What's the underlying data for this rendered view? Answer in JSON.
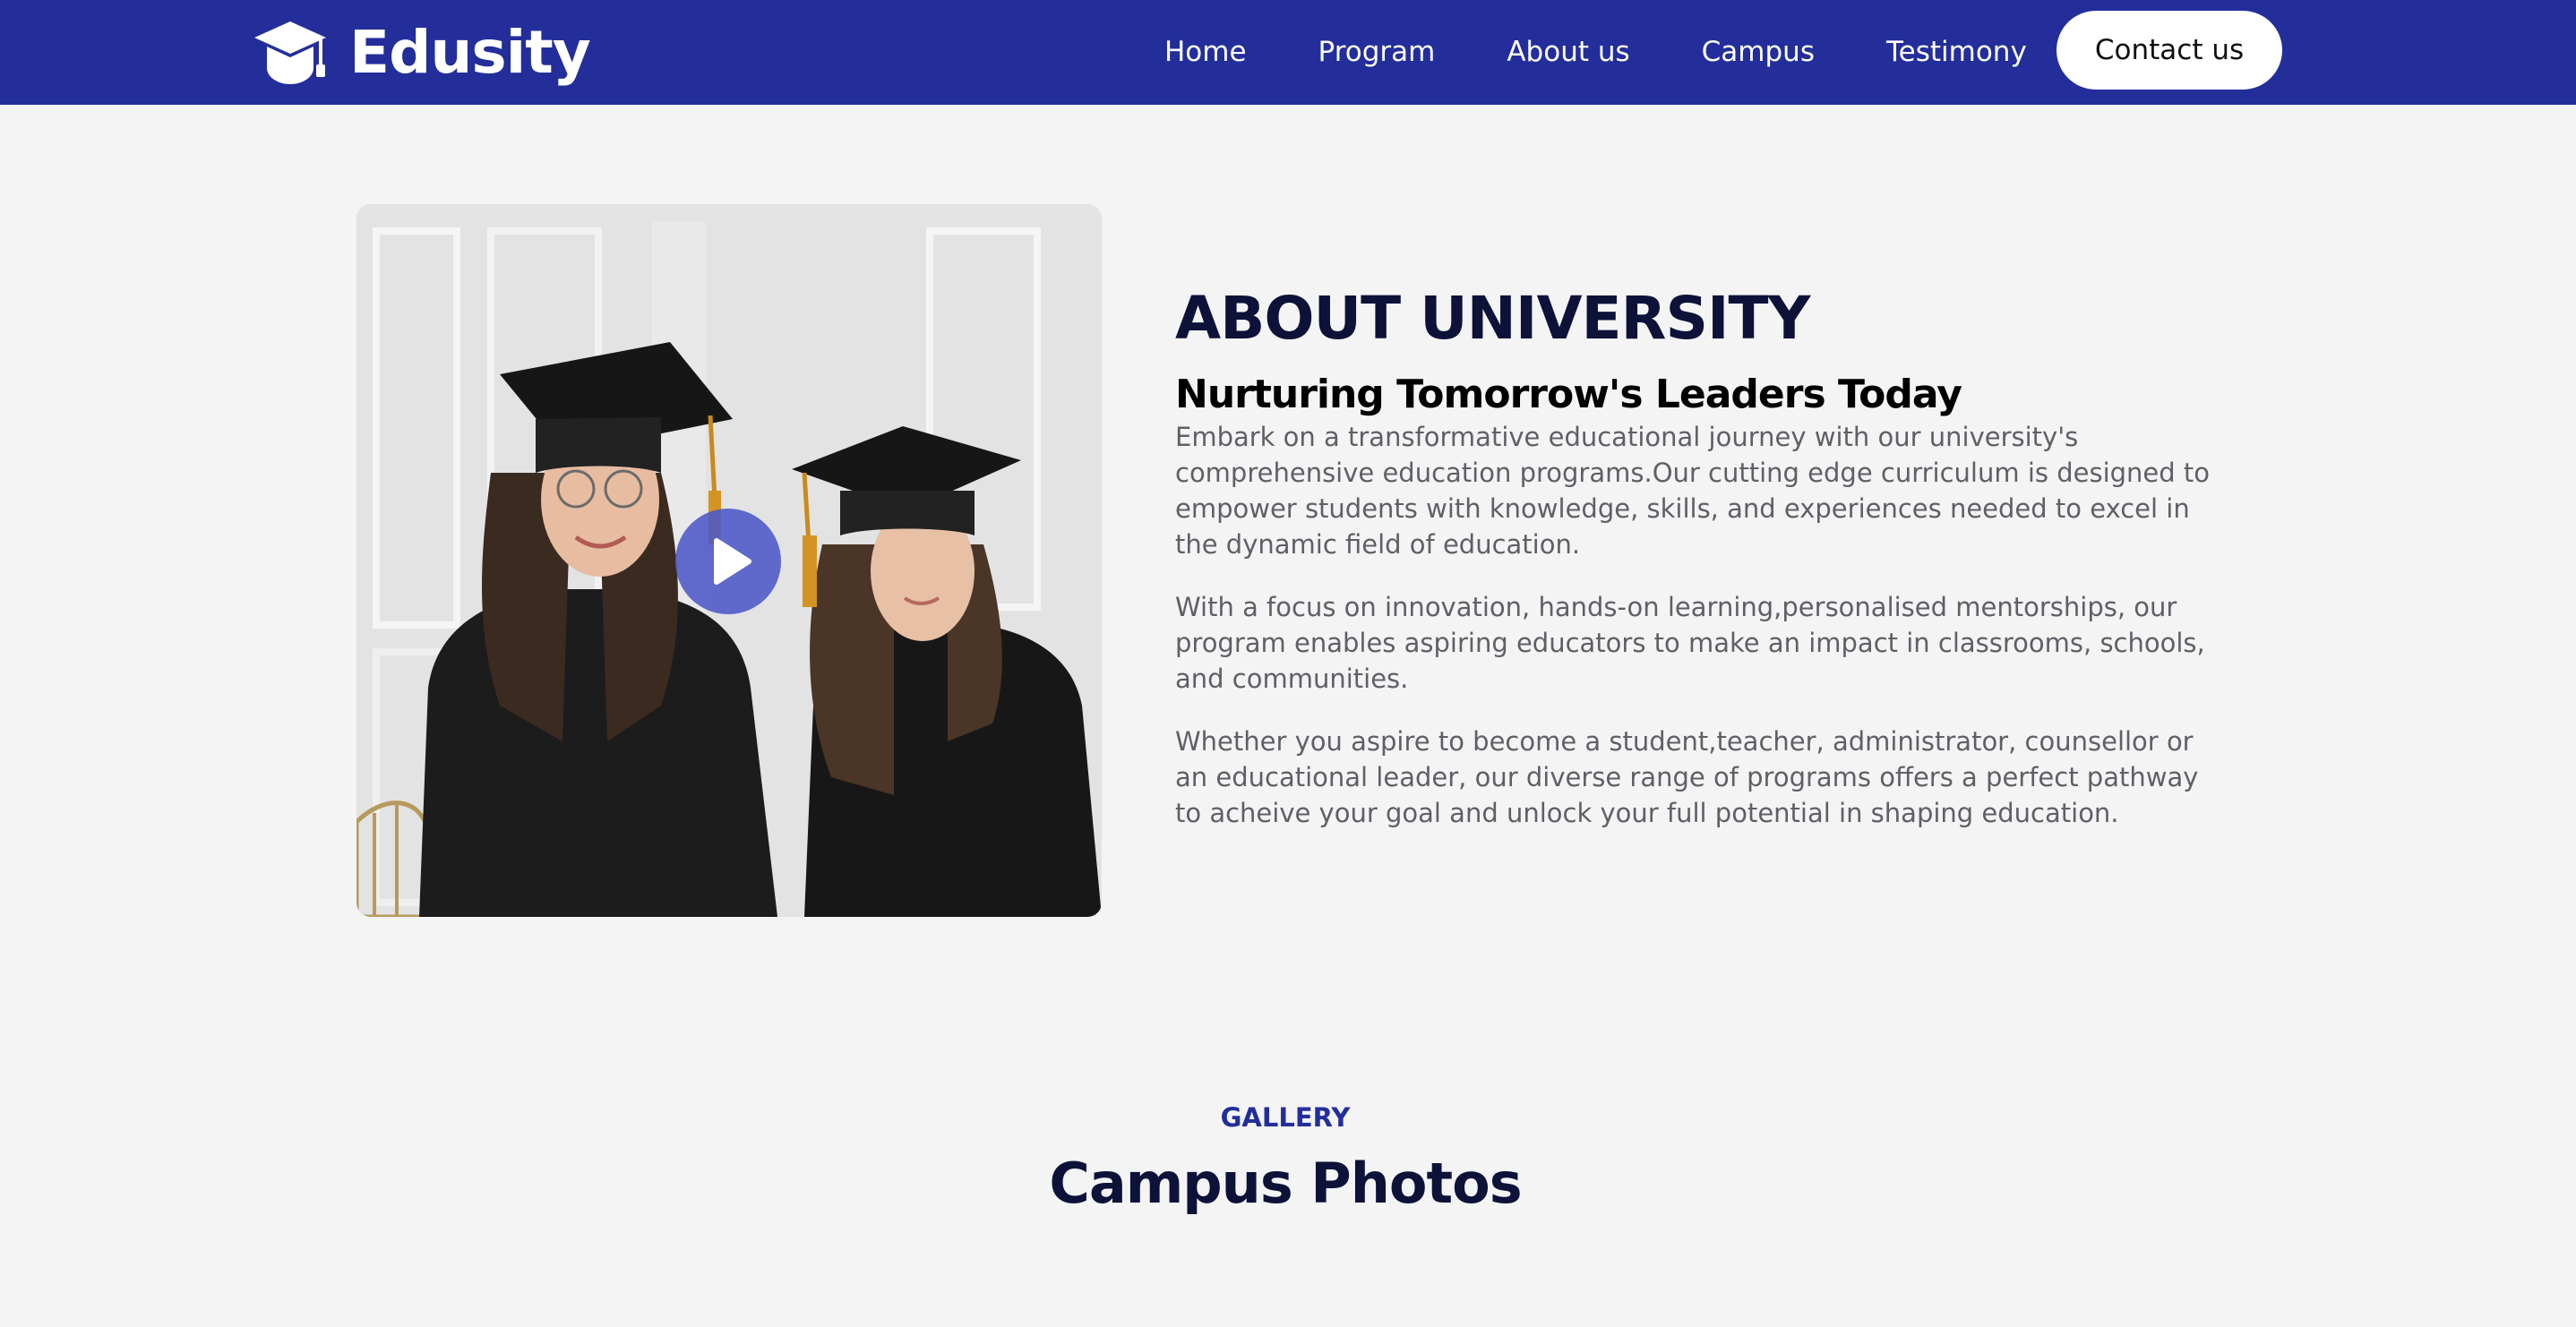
{
  "navbar": {
    "logo_text": "Edusity",
    "links": [
      "Home",
      "Program",
      "About us",
      "Campus",
      "Testimony"
    ],
    "contact_label": "Contact us"
  },
  "about": {
    "heading": "ABOUT UNIVERSITY",
    "subheading": "Nurturing Tomorrow's Leaders Today",
    "paragraphs": [
      "Embark on a transformative educational journey with our university's comprehensive education programs.Our cutting edge curriculum is designed to empower students with knowledge, skills, and experiences needed to excel in the dynamic field of education.",
      "With a focus on innovation, hands-on learning,personalised mentorships, our program enables aspiring educators to make an impact in classrooms, schools, and communities.",
      "Whether you aspire to become a student,teacher, administrator, counsellor or an educational leader, our diverse range of programs offers a perfect pathway to acheive your goal and unlock your full potential in shaping education."
    ],
    "image_icon": "graduates-photo",
    "play_icon": "play-icon"
  },
  "gallery": {
    "label": "GALLERY",
    "title": "Campus Photos"
  },
  "colors": {
    "nav_bg": "#232e9b",
    "page_bg": "#f4f4f5",
    "heading": "#0c1238",
    "body_text": "#5f5f66",
    "play_bg": "#4c58c8"
  }
}
